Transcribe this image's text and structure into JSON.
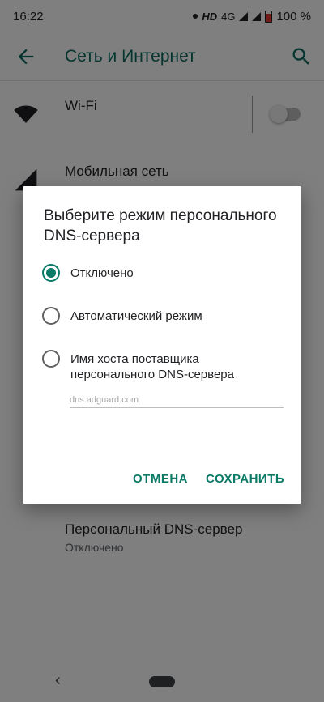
{
  "status_bar": {
    "time": "16:22",
    "network": "HD",
    "network_gen": "4G",
    "battery": "100 %"
  },
  "app_bar": {
    "title": "Сеть и Интернет",
    "back_icon": "arrow-back-icon",
    "search_icon": "search-icon"
  },
  "settings": {
    "wifi_title": "Wi-Fi",
    "mobile_title": "Мобильная сеть",
    "dns_title": "Персональный DNS-сервер",
    "dns_subtitle": "Отключено"
  },
  "dialog": {
    "title": "Выберите режим персонального DNS-сервера",
    "options": [
      {
        "label": "Отключено",
        "checked": true
      },
      {
        "label": "Автоматический режим",
        "checked": false
      },
      {
        "label": "Имя хоста поставщика персонального DNS-сервера",
        "checked": false
      }
    ],
    "hostname_placeholder": "dns.adguard.com",
    "cancel_label": "ОТМЕНА",
    "save_label": "СОХРАНИТЬ"
  },
  "colors": {
    "accent": "#0b7a66",
    "title_accent": "#0b6b5c",
    "scrim": "rgba(0,0,0,0.5)"
  }
}
